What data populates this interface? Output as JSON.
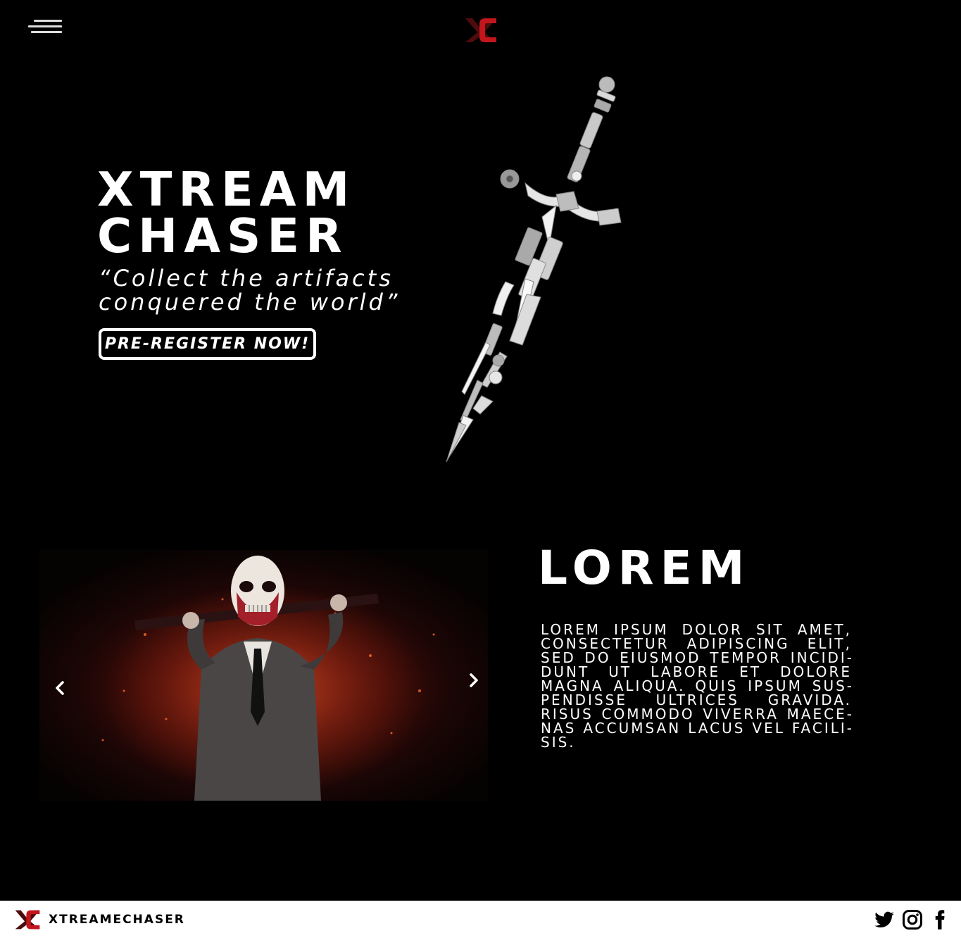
{
  "header": {
    "menu_icon": "hamburger-menu-icon",
    "logo_icon": "xc-logo-icon"
  },
  "hero": {
    "title_line1": "XTREAM",
    "title_line2": "CHASER",
    "tagline_line1": "“Collect the artifacts",
    "tagline_line2": "conquered the world”",
    "cta_label": "PRE-REGISTER NOW!",
    "artwork_icon": "weapon-collage-sword-icon"
  },
  "carousel": {
    "prev_icon": "chevron-left-icon",
    "next_icon": "chevron-right-icon",
    "slide_icon": "masked-character-image"
  },
  "section": {
    "title": "LOREM",
    "body": "LOREM IPSUM DOLOR SIT AMET, CONSECTETUR ADIPISCING ELIT, SED DO EIUSMOD TEMPOR INCIDI­DUNT UT LABORE ET DOLORE MAGNA ALIQUA. QUIS IPSUM SUS­PENDISSE ULTRICES GRAVIDA. RISUS COMMODO VIVERRA MAECE­NAS ACCUMSAN LACUS VEL FACILI­SIS."
  },
  "footer": {
    "brand": "XTREAMECHASER",
    "social": [
      "twitter-icon",
      "instagram-icon",
      "facebook-icon"
    ]
  },
  "colors": {
    "background": "#000000",
    "text": "#ffffff",
    "brand_red": "#b3161c",
    "footer_bg": "#ffffff"
  }
}
